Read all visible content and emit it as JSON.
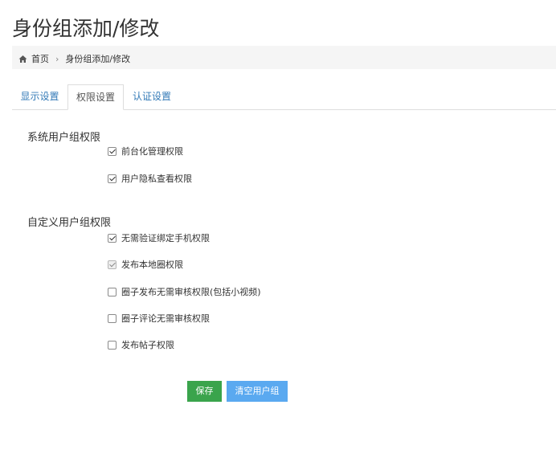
{
  "page": {
    "title": "身份组添加/修改"
  },
  "breadcrumb": {
    "home_label": "首页",
    "current_label": "身份组添加/修改"
  },
  "tabs": [
    {
      "label": "显示设置",
      "active": false
    },
    {
      "label": "权限设置",
      "active": true
    },
    {
      "label": "认证设置",
      "active": false
    }
  ],
  "system_section": {
    "title": "系统用户组权限",
    "items": [
      {
        "label": "前台化管理权限",
        "checked": true
      },
      {
        "label": "用户隐私查看权限",
        "checked": true
      }
    ]
  },
  "custom_section": {
    "title": "自定义用户组权限",
    "items": [
      {
        "label": "无需验证绑定手机权限",
        "checked": true
      },
      {
        "label": "发布本地圈权限",
        "checked": true,
        "disabled": true
      },
      {
        "label": "圈子发布无需审核权限(包括小视频)",
        "checked": false
      },
      {
        "label": "圈子评论无需审核权限",
        "checked": false
      },
      {
        "label": "发布帖子权限",
        "checked": false
      }
    ]
  },
  "buttons": {
    "save_label": "保存",
    "clear_label": "清空用户组"
  },
  "colors": {
    "save_button": "#3aa44c",
    "clear_button": "#5aa9f0",
    "tab_link": "#337ab7"
  },
  "icons": {
    "breadcrumb_home": "home-icon",
    "breadcrumb_separator": "chevron-right-icon"
  }
}
